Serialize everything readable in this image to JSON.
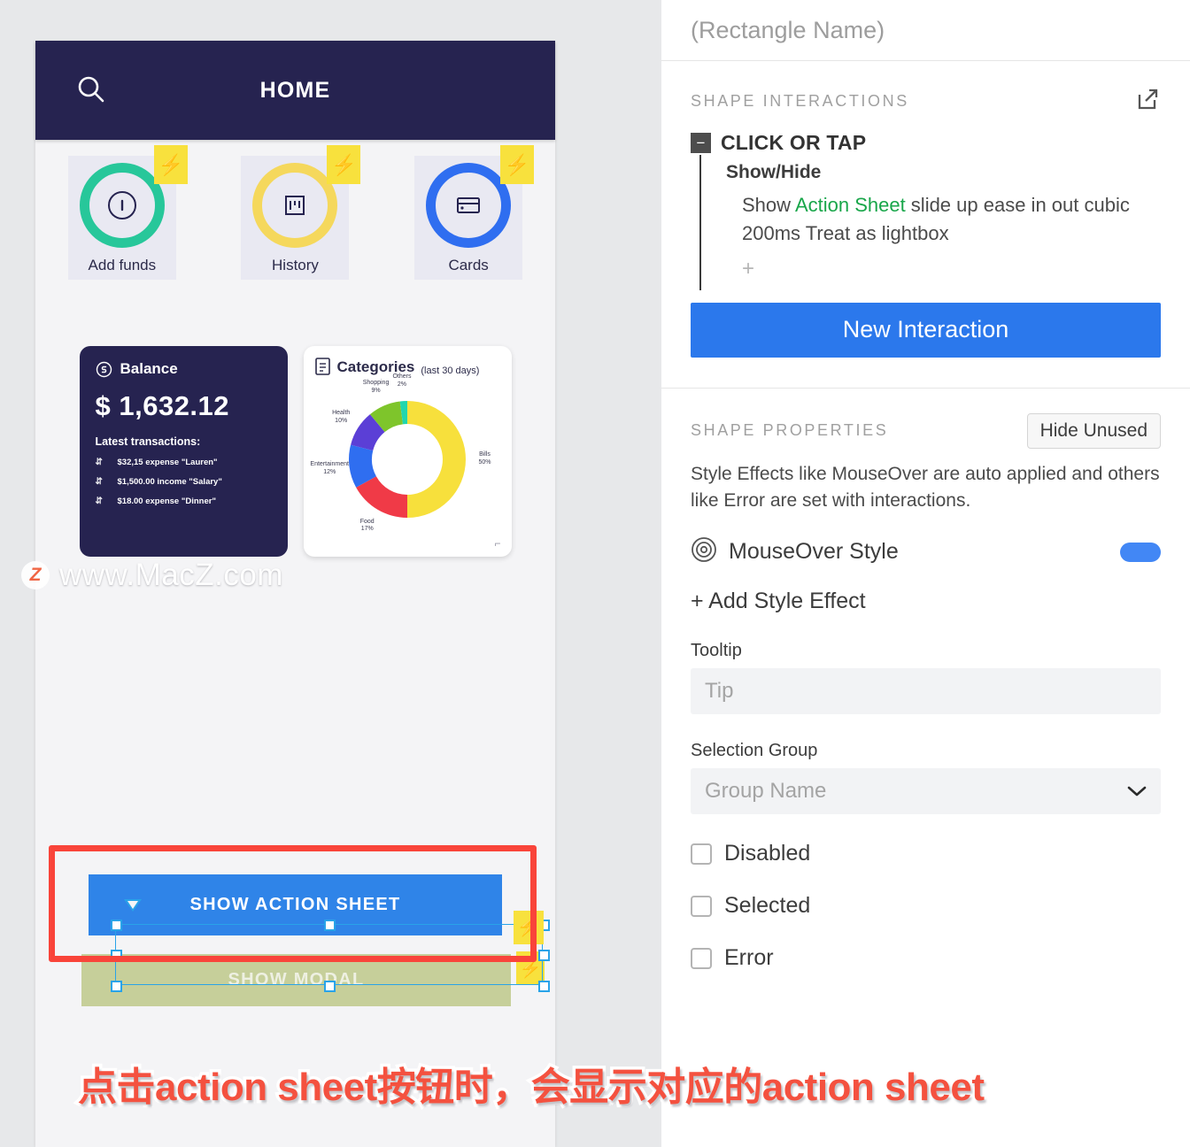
{
  "canvas": {
    "watermark": {
      "badge": "Z",
      "text": "www.MacZ.com"
    },
    "caption": "点击action sheet按钮时，会显示对应的action sheet",
    "selection": {
      "bolt_icon": "lightning-bolt-icon",
      "triangle_icon": "anchor-triangle-icon"
    },
    "annotation_color": "#f9443a"
  },
  "phone": {
    "appbar": {
      "title": "HOME",
      "search_icon": "search-icon",
      "bg": "#262350"
    },
    "quick_actions": [
      {
        "label": "Add funds",
        "ring_color": "#27c79a",
        "icon": "coin-icon",
        "badge_icon": "lightning-bolt-icon"
      },
      {
        "label": "History",
        "ring_color": "#f5d85c",
        "icon": "chart-bars-icon",
        "badge_icon": "lightning-bolt-icon"
      },
      {
        "label": "Cards",
        "ring_color": "#2f6ef0",
        "icon": "credit-card-icon",
        "badge_icon": "lightning-bolt-icon"
      }
    ],
    "balance_card": {
      "icon": "dollar-circle-icon",
      "title": "Balance",
      "amount": "$ 1,632.12",
      "transactions_label": "Latest transactions:",
      "transactions": [
        {
          "icon": "transfer-icon",
          "arrow": "arrow-up-icon",
          "text": "$32,15 expense \"Lauren\""
        },
        {
          "icon": "transfer-icon",
          "arrow": "arrow-down-icon",
          "text": "$1,500.00 income \"Salary\""
        },
        {
          "icon": "transfer-icon",
          "arrow": "arrow-down-icon",
          "text": "$18.00 expense \"Dinner\""
        }
      ]
    },
    "categories_card": {
      "icon": "list-document-icon",
      "title": "Categories",
      "subtitle": "(last 30 days)",
      "resize_icon": "resize-handle-icon"
    },
    "buttons": {
      "action_sheet": "SHOW ACTION SHEET",
      "modal": "SHOW MODAL"
    }
  },
  "chart_data": {
    "type": "pie",
    "title": "Categories",
    "subtitle": "(last 30 days)",
    "donut": true,
    "categories": [
      "Bills",
      "Food",
      "Entertainment",
      "Health",
      "Shopping",
      "Others"
    ],
    "values": [
      50,
      17,
      12,
      10,
      9,
      2
    ],
    "labels": [
      "Bills\n50%",
      "Food\n17%",
      "Entertainment\n12%",
      "Health\n10%",
      "Shopping\n9%",
      "Others\n2%"
    ],
    "colors": [
      "#f7e03c",
      "#f03a47",
      "#2f6ef0",
      "#5b3fd6",
      "#7ec52b",
      "#21d6ae"
    ],
    "legend": "labels-outside",
    "unit": "%"
  },
  "panel": {
    "name_placeholder": "(Rectangle Name)",
    "interactions": {
      "section_title": "SHAPE INTERACTIONS",
      "expand_icon": "external-link-icon",
      "event_label": "CLICK OR TAP",
      "collapse_icon": "minus-icon",
      "action_title": "Show/Hide",
      "action_desc_pre": "Show ",
      "action_desc_target": "Action Sheet",
      "action_desc_post": " slide up ease in out cubic 200ms Treat as lightbox",
      "add_case_icon": "plus-icon",
      "new_interaction_label": "New Interaction",
      "button_color": "#2b78ec",
      "target_color": "#19a64a"
    },
    "properties": {
      "section_title": "SHAPE PROPERTIES",
      "hide_unused_label": "Hide Unused",
      "note": "Style Effects like MouseOver are auto applied and others like Error are set with interactions.",
      "mouseover_icon": "target-circles-icon",
      "mouseover_label": "MouseOver Style",
      "mouseover_enabled": true,
      "toggle_color": "#4287f5",
      "add_style_label": "+ Add Style Effect",
      "tooltip_label": "Tooltip",
      "tooltip_placeholder": "Tip",
      "tooltip_value": "",
      "selection_group_label": "Selection Group",
      "selection_group_placeholder": "Group Name",
      "selection_group_value": "",
      "dropdown_icon": "chevron-down-icon",
      "checkboxes": [
        {
          "label": "Disabled",
          "checked": false
        },
        {
          "label": "Selected",
          "checked": false
        },
        {
          "label": "Error",
          "checked": false
        }
      ]
    }
  }
}
